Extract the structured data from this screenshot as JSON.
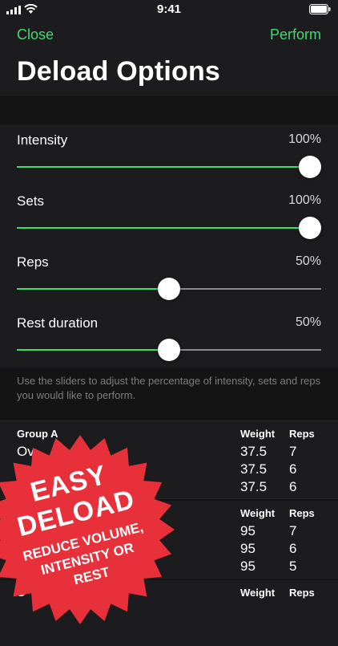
{
  "status": {
    "time": "9:41"
  },
  "nav": {
    "close_label": "Close",
    "perform_label": "Perform"
  },
  "page": {
    "title": "Deload Options"
  },
  "accent_color": "#3ddc6e",
  "sliders": [
    {
      "label": "Intensity",
      "value_text": "100%",
      "value": 100
    },
    {
      "label": "Sets",
      "value_text": "100%",
      "value": 100
    },
    {
      "label": "Reps",
      "value_text": "50%",
      "value": 50
    },
    {
      "label": "Rest duration",
      "value_text": "50%",
      "value": 50
    }
  ],
  "help_text": "Use the sliders to adjust the percentage of intensity, sets and reps you would like to perform.",
  "groups": [
    {
      "title": "Group A",
      "weight_header": "Weight",
      "reps_header": "Reps",
      "exercise_partial": "Ov",
      "rows": [
        {
          "weight": "37.5",
          "reps": "7"
        },
        {
          "weight": "37.5",
          "reps": "6"
        },
        {
          "weight": "37.5",
          "reps": "6"
        }
      ]
    },
    {
      "weight_header": "Weight",
      "reps_header": "Reps",
      "rows": [
        {
          "weight": "95",
          "reps": "7"
        },
        {
          "weight": "95",
          "reps": "6"
        },
        {
          "weight": "95",
          "reps": "5"
        }
      ]
    },
    {
      "title_partial": "G",
      "weight_header": "Weight",
      "reps_header": "Reps"
    }
  ],
  "promo_badge": {
    "line1": "EASY",
    "line2": "DELOAD",
    "line3": "REDUCE VOLUME,",
    "line4": "INTENSITY OR",
    "line5": "REST",
    "color": "#e8303a"
  }
}
